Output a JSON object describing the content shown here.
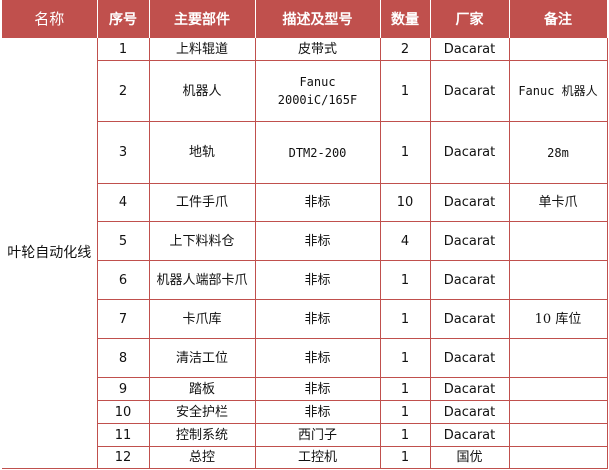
{
  "table": {
    "headers": [
      "名称",
      "序号",
      "主要部件",
      "描述及型号",
      "数量",
      "厂家",
      "备注"
    ],
    "group_name": "叶轮自动化线",
    "rows": [
      {
        "no": "1",
        "part": "上料辊道",
        "desc": "皮带式",
        "qty": "2",
        "maker": "Dacarat",
        "note": ""
      },
      {
        "no": "2",
        "part": "机器人",
        "desc": "Fanuc\n2000iC/165F",
        "qty": "1",
        "maker": "Dacarat",
        "note": "Fanuc 机器人"
      },
      {
        "no": "3",
        "part": "地轨",
        "desc": "DTM2-200",
        "qty": "1",
        "maker": "Dacarat",
        "note": "28m"
      },
      {
        "no": "4",
        "part": "工件手爪",
        "desc": "非标",
        "qty": "10",
        "maker": "Dacarat",
        "note": "单卡爪"
      },
      {
        "no": "5",
        "part": "上下料料仓",
        "desc": "非标",
        "qty": "4",
        "maker": "Dacarat",
        "note": ""
      },
      {
        "no": "6",
        "part": "机器人端部卡爪",
        "desc": "非标",
        "qty": "1",
        "maker": "Dacarat",
        "note": ""
      },
      {
        "no": "7",
        "part": "卡爪库",
        "desc": "非标",
        "qty": "1",
        "maker": "Dacarat",
        "note": "10 库位"
      },
      {
        "no": "8",
        "part": "清洁工位",
        "desc": "非标",
        "qty": "1",
        "maker": "Dacarat",
        "note": ""
      },
      {
        "no": "9",
        "part": "踏板",
        "desc": "非标",
        "qty": "1",
        "maker": "Dacarat",
        "note": ""
      },
      {
        "no": "10",
        "part": "安全护栏",
        "desc": "非标",
        "qty": "1",
        "maker": "Dacarat",
        "note": ""
      },
      {
        "no": "11",
        "part": "控制系统",
        "desc": "西门子",
        "qty": "1",
        "maker": "Dacarat",
        "note": ""
      },
      {
        "no": "12",
        "part": "总控",
        "desc": "工控机",
        "qty": "1",
        "maker": "国优",
        "note": ""
      }
    ]
  },
  "colors": {
    "header_bg": "#c0504d",
    "border": "#c0504d",
    "header_text": "#ffffff"
  }
}
